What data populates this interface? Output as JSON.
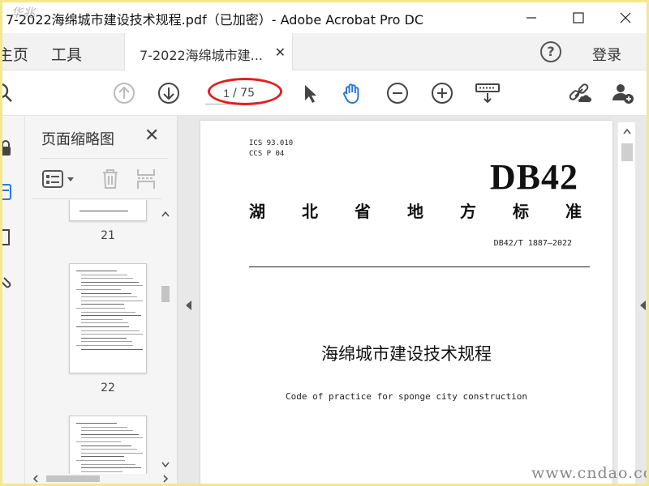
{
  "window": {
    "title": "7-2022海绵城市建设技术规程.pdf（已加密）- Adobe Acrobat Pro DC",
    "watermark": "华兆"
  },
  "tabs": {
    "home_label": "主页",
    "tools_label": "工具",
    "doc_label": "7-2022海绵城市建...",
    "help_label": "?",
    "login_label": "登录"
  },
  "toolbar": {
    "page_current": "1",
    "page_total": "/ 75",
    "icons": [
      "search-icon",
      "prev-page-icon",
      "next-page-icon",
      "select-cursor-icon",
      "hand-tool-icon",
      "zoom-out-icon",
      "zoom-in-icon",
      "page-display-icon",
      "share-link-icon",
      "add-user-icon"
    ],
    "accent_color": "#2d77d4",
    "highlight_color": "#e02020"
  },
  "sidebar": {
    "panel_title": "页面缩略图",
    "thumbnails": [
      {
        "page": "21"
      },
      {
        "page": "22"
      },
      {
        "page": ""
      }
    ]
  },
  "document": {
    "ics_line": "ICS  93.010",
    "ccs_line": "CCS  P 04",
    "code": "DB42",
    "province_chars": [
      "湖",
      "北",
      "省",
      "地",
      "方",
      "标",
      "准"
    ],
    "standard_number": "DB42/T 1887—2022",
    "title_cn": "海绵城市建设技术规程",
    "title_en": "Code of practice for sponge city construction"
  },
  "footer": {
    "site_watermark": "www.cndao.com"
  }
}
